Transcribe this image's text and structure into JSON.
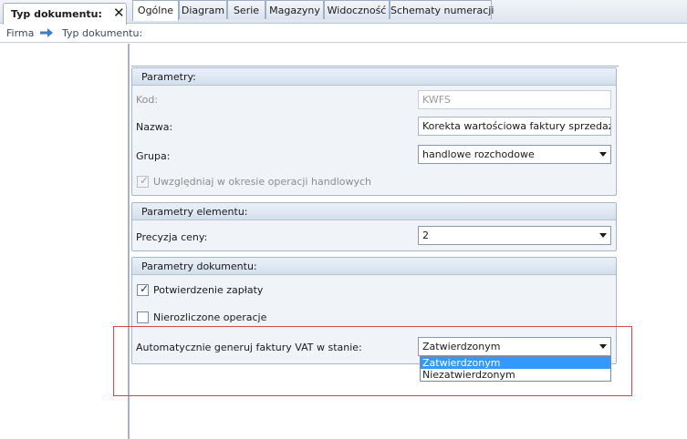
{
  "document_tab": {
    "title": "Typ dokumentu:"
  },
  "breadcrumb": {
    "items": [
      "Firma",
      "Typ dokumentu:"
    ]
  },
  "tabs": [
    {
      "label": "Ogólne",
      "active": true
    },
    {
      "label": "Diagram",
      "active": false
    },
    {
      "label": "Serie",
      "active": false
    },
    {
      "label": "Magazyny",
      "active": false
    },
    {
      "label": "Widoczność",
      "active": false
    },
    {
      "label": "Schematy numeracji",
      "active": false
    }
  ],
  "parametry": {
    "title": "Parametry:",
    "kod": {
      "label": "Kod:",
      "value": "KWFS"
    },
    "nazwa": {
      "label": "Nazwa:",
      "value": "Korekta wartościowa faktury sprzedaży"
    },
    "grupa": {
      "label": "Grupa:",
      "value": "handlowe rozchodowe"
    },
    "uwzgledniaj": {
      "label": "Uwzględniaj w okresie operacji handlowych",
      "checked": true
    }
  },
  "parametry_elementu": {
    "title": "Parametry elementu:",
    "precyzja": {
      "label": "Precyzja ceny:",
      "value": "2"
    }
  },
  "parametry_dokumentu": {
    "title": "Parametry dokumentu:",
    "potwierdzenie": {
      "label": "Potwierdzenie zapłaty",
      "checked": true
    },
    "nierozliczone": {
      "label": "Nierozliczone operacje",
      "checked": false
    },
    "automatycznie": {
      "label": "Automatycznie generuj faktury VAT w stanie:",
      "value": "Zatwierdzonym",
      "options": [
        "Zatwierdzonym",
        "Niezatwierdzonym"
      ]
    }
  },
  "colors": {
    "highlight": "#d84848",
    "selection": "#3399ff",
    "accent_border": "#9fb0c8"
  }
}
